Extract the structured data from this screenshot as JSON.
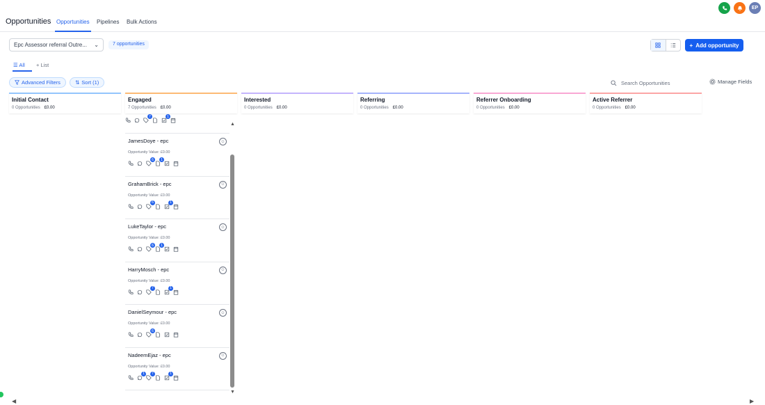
{
  "header": {
    "title": "Opportunities",
    "tabs": [
      {
        "label": "Opportunities",
        "active": true
      },
      {
        "label": "Pipelines",
        "active": false
      },
      {
        "label": "Bulk Actions",
        "active": false
      }
    ],
    "avatar_initials": "EP",
    "icons": [
      "phone-icon",
      "bell-icon"
    ]
  },
  "toolbar": {
    "pipeline_value": "Epc Assessor referral Outre...",
    "opportunity_count": "7 opportunities",
    "add_label": "Add opportunity"
  },
  "subtabs": [
    {
      "label": "All",
      "active": true
    },
    {
      "label": "List",
      "active": false
    }
  ],
  "filters": {
    "advanced_label": "Advanced Filters",
    "sort_label": "Sort (1)",
    "search_placeholder": "Search Opportunities",
    "manage_fields_label": "Manage Fields"
  },
  "columns": [
    {
      "name": "Initial Contact",
      "count": "0 Opportunities",
      "value": "£0.00",
      "color": "#93c5fd"
    },
    {
      "name": "Engaged",
      "count": "7 Opportunities",
      "value": "£0.00",
      "color": "#fdba74"
    },
    {
      "name": "Interested",
      "count": "0 Opportunities",
      "value": "£0.00",
      "color": "#c4b5fd"
    },
    {
      "name": "Referring",
      "count": "0 Opportunities",
      "value": "£0.00",
      "color": "#a5b4fc"
    },
    {
      "name": "Referrer Onboarding",
      "count": "0 Opportunities",
      "value": "£0.00",
      "color": "#f9a8d4"
    },
    {
      "name": "Active Referrer",
      "count": "0 Opportunities",
      "value": "£0.00",
      "color": "#fca5a5"
    }
  ],
  "top_actions": {
    "badges": [
      "",
      "",
      "7",
      "",
      "1",
      ""
    ]
  },
  "cards": [
    {
      "name": "JamesDoye - epc",
      "value_label": "Opportunity Value:",
      "value": "£0.00",
      "badges": [
        "",
        "",
        "6",
        "1",
        "",
        ""
      ]
    },
    {
      "name": "GrahamBrick - epc",
      "value_label": "Opportunity Value:",
      "value": "£0.00",
      "badges": [
        "",
        "",
        "6",
        "",
        "1",
        ""
      ]
    },
    {
      "name": "LukeTaylor - epc",
      "value_label": "Opportunity Value:",
      "value": "£0.00",
      "badges": [
        "",
        "",
        "6",
        "1",
        "",
        ""
      ]
    },
    {
      "name": "HarryMosch - epc",
      "value_label": "Opportunity Value:",
      "value": "£0.00",
      "badges": [
        "",
        "",
        "7",
        "",
        "1",
        ""
      ]
    },
    {
      "name": "DanielSeymour - epc",
      "value_label": "Opportunity Value:",
      "value": "£0.00",
      "badges": [
        "",
        "",
        "6",
        "",
        "",
        ""
      ]
    },
    {
      "name": "NadeemEjaz - epc",
      "value_label": "Opportunity Value:",
      "value": "£0.00",
      "badges": [
        "",
        "1",
        "7",
        "",
        "1",
        ""
      ]
    }
  ]
}
